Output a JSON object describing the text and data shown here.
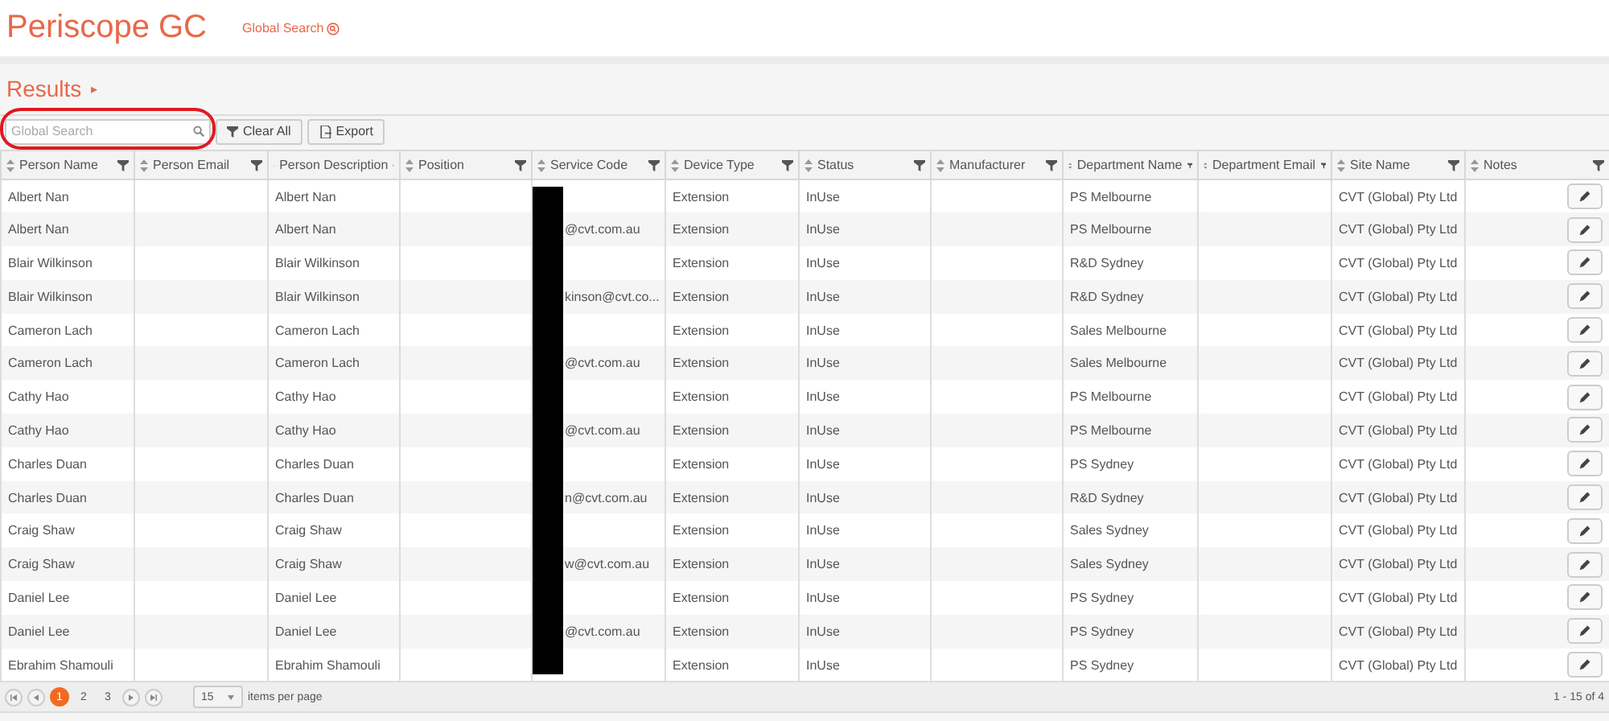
{
  "header": {
    "title": "Periscope GC",
    "link": "Global Search"
  },
  "results": {
    "title": "Results",
    "arrow": "▸"
  },
  "toolbar": {
    "search": {
      "placeholder": "Global Search"
    },
    "buttons": [
      "Clear All",
      "Export"
    ]
  },
  "table": {
    "columns": [
      "Person Name",
      "Person Email",
      "Person Description",
      "Position",
      "Service Code",
      "Device Type",
      "Status",
      "Manufacturer",
      "Department Name",
      "Department Email",
      "Site Name",
      "Notes"
    ],
    "rows": [
      {
        "person_name": "Albert Nan",
        "person_description": "Albert Nan",
        "device_type": "Extension",
        "status": "InUse",
        "department_name": "PS Melbourne",
        "site_name": "CVT (Global) Pty Ltd"
      },
      {
        "person_name": "Albert Nan",
        "person_description": "Albert Nan",
        "service_code": "@cvt.com.au",
        "device_type": "Extension",
        "status": "InUse",
        "department_name": "PS Melbourne",
        "site_name": "CVT (Global) Pty Ltd"
      },
      {
        "person_name": "Blair Wilkinson",
        "person_description": "Blair Wilkinson",
        "device_type": "Extension",
        "status": "InUse",
        "department_name": "R&D Sydney",
        "site_name": "CVT (Global) Pty Ltd"
      },
      {
        "person_name": "Blair Wilkinson",
        "person_description": "Blair Wilkinson",
        "service_code": "kinson@cvt.co...",
        "device_type": "Extension",
        "status": "InUse",
        "department_name": "R&D Sydney",
        "site_name": "CVT (Global) Pty Ltd"
      },
      {
        "person_name": "Cameron Lach",
        "person_description": "Cameron Lach",
        "device_type": "Extension",
        "status": "InUse",
        "department_name": "Sales Melbourne",
        "site_name": "CVT (Global) Pty Ltd"
      },
      {
        "person_name": "Cameron Lach",
        "person_description": "Cameron Lach",
        "service_code": "@cvt.com.au",
        "device_type": "Extension",
        "status": "InUse",
        "department_name": "Sales Melbourne",
        "site_name": "CVT (Global) Pty Ltd"
      },
      {
        "person_name": "Cathy Hao",
        "person_description": "Cathy Hao",
        "device_type": "Extension",
        "status": "InUse",
        "department_name": "PS Melbourne",
        "site_name": "CVT (Global) Pty Ltd"
      },
      {
        "person_name": "Cathy Hao",
        "person_description": "Cathy Hao",
        "service_code": "@cvt.com.au",
        "device_type": "Extension",
        "status": "InUse",
        "department_name": "PS Melbourne",
        "site_name": "CVT (Global) Pty Ltd"
      },
      {
        "person_name": "Charles Duan",
        "person_description": "Charles Duan",
        "device_type": "Extension",
        "status": "InUse",
        "department_name": "PS Sydney",
        "site_name": "CVT (Global) Pty Ltd"
      },
      {
        "person_name": "Charles Duan",
        "person_description": "Charles Duan",
        "service_code": "n@cvt.com.au",
        "device_type": "Extension",
        "status": "InUse",
        "department_name": "R&D Sydney",
        "site_name": "CVT (Global) Pty Ltd"
      },
      {
        "person_name": "Craig Shaw",
        "person_description": "Craig Shaw",
        "device_type": "Extension",
        "status": "InUse",
        "department_name": "Sales Sydney",
        "site_name": "CVT (Global) Pty Ltd"
      },
      {
        "person_name": "Craig Shaw",
        "person_description": "Craig Shaw",
        "service_code": "w@cvt.com.au",
        "device_type": "Extension",
        "status": "InUse",
        "department_name": "Sales Sydney",
        "site_name": "CVT (Global) Pty Ltd"
      },
      {
        "person_name": "Daniel Lee",
        "person_description": "Daniel Lee",
        "device_type": "Extension",
        "status": "InUse",
        "department_name": "PS Sydney",
        "site_name": "CVT (Global) Pty Ltd"
      },
      {
        "person_name": "Daniel Lee",
        "person_description": "Daniel Lee",
        "service_code": "@cvt.com.au",
        "device_type": "Extension",
        "status": "InUse",
        "department_name": "PS Sydney",
        "site_name": "CVT (Global) Pty Ltd"
      },
      {
        "person_name": "Ebrahim Shamouli",
        "person_description": "Ebrahim Shamouli",
        "device_type": "Extension",
        "status": "InUse",
        "department_name": "PS Sydney",
        "site_name": "CVT (Global) Pty Ltd"
      }
    ]
  },
  "pager": {
    "pages": [
      {
        "label": "1",
        "selected": true
      },
      {
        "label": "2",
        "selected": false
      },
      {
        "label": "3",
        "selected": false
      }
    ],
    "page_size": "15",
    "page_size_label": "items per page",
    "summary": "1 - 15 of 4"
  }
}
